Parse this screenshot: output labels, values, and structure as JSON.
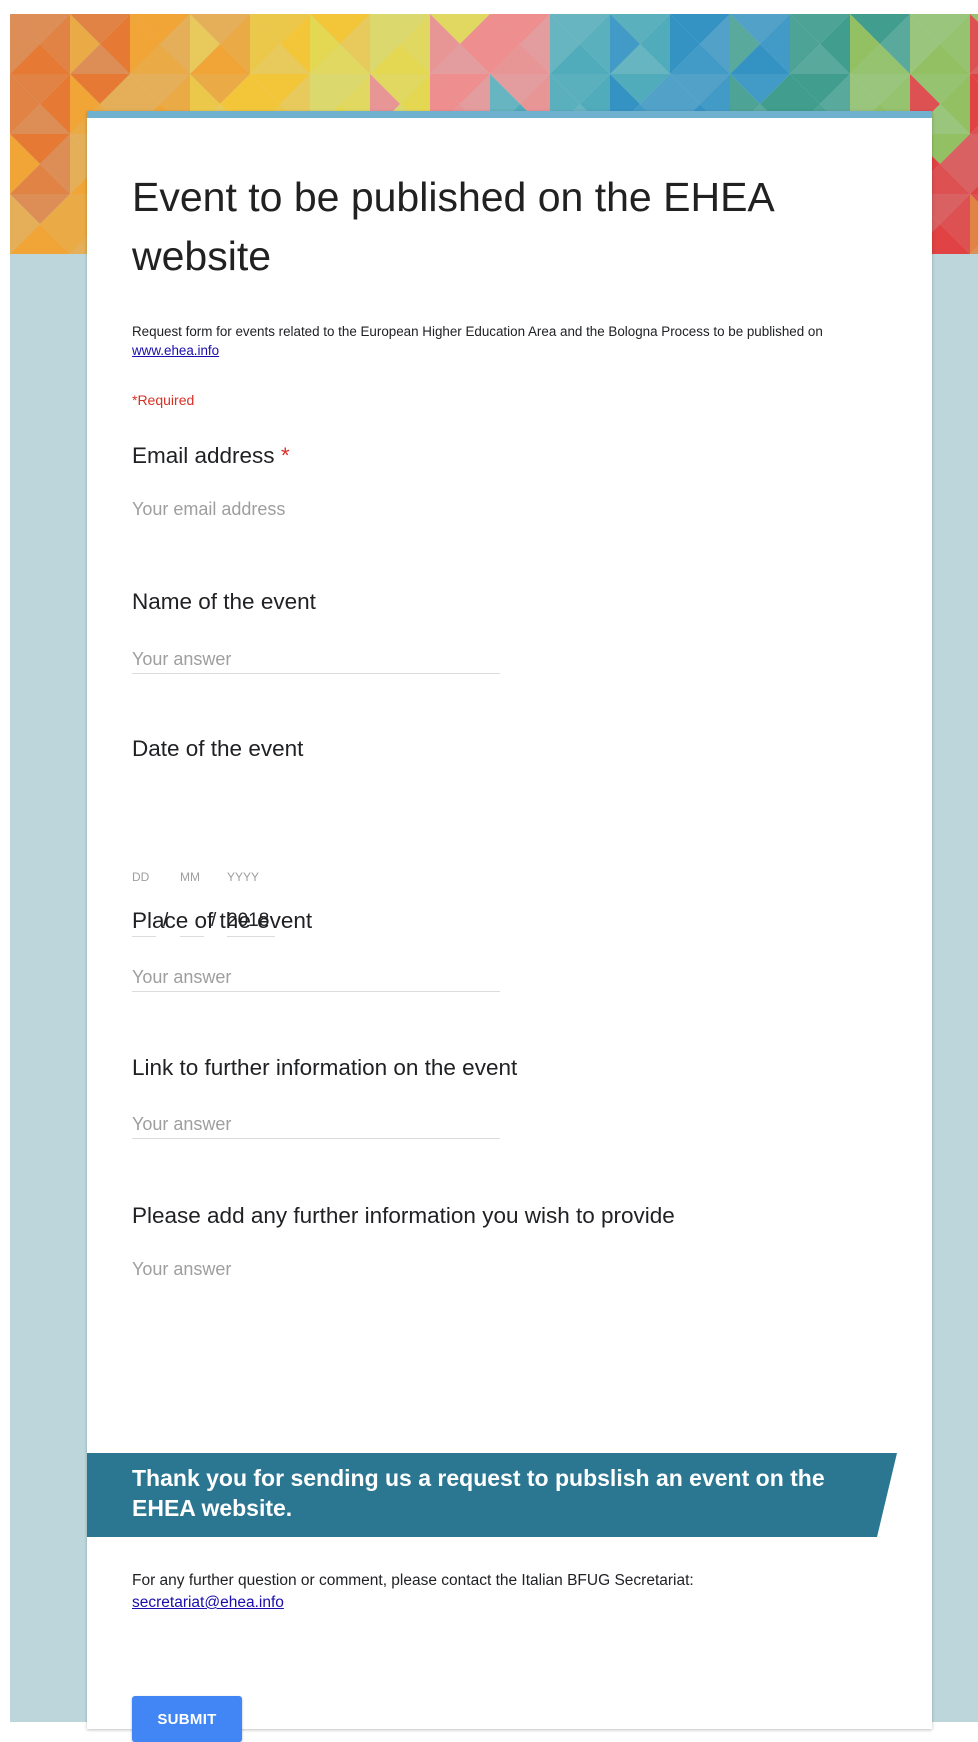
{
  "form": {
    "title": "Event to be published on the EHEA website",
    "description_text": "Request form for events related to the European Higher Education Area and the Bologna Process to be published on ",
    "description_link": "www.ehea.info",
    "required_note": "*Required",
    "submit_label": "SUBMIT"
  },
  "questions": {
    "email": {
      "label": "Email address",
      "required_mark": "*",
      "placeholder": "Your email address"
    },
    "name": {
      "label": "Name of the event",
      "placeholder": "Your answer"
    },
    "date": {
      "label": "Date of the event",
      "day_label": "DD",
      "month_label": "MM",
      "year_label": "YYYY",
      "day_value": "",
      "month_value": "",
      "year_value": "2018",
      "separator": "/"
    },
    "place": {
      "label": "Place of the event",
      "placeholder": "Your answer"
    },
    "link": {
      "label": "Link to further information on the event",
      "placeholder": "Your answer"
    },
    "further": {
      "label": "Please add any further information you wish to provide",
      "placeholder": "Your answer"
    }
  },
  "section": {
    "title": "Thank you for sending us a request to pubslish an event on the EHEA website.",
    "description_text": "For any further question or comment, please contact the Italian BFUG Secretariat: ",
    "contact_link": "secretariat@ehea.info"
  },
  "colors": {
    "page_background": "#bcd6dc",
    "card_top_border": "#6fb1cf",
    "section_banner": "#2b7791",
    "required": "#d93025",
    "submit_button": "#4285f4",
    "header_palette": [
      "#e8742a",
      "#f2a22c",
      "#f5c530",
      "#e6d84a",
      "#f08a8a",
      "#4aa9b8",
      "#2d8fc2",
      "#3a9a88",
      "#8fbf5c",
      "#e33a3a"
    ]
  }
}
